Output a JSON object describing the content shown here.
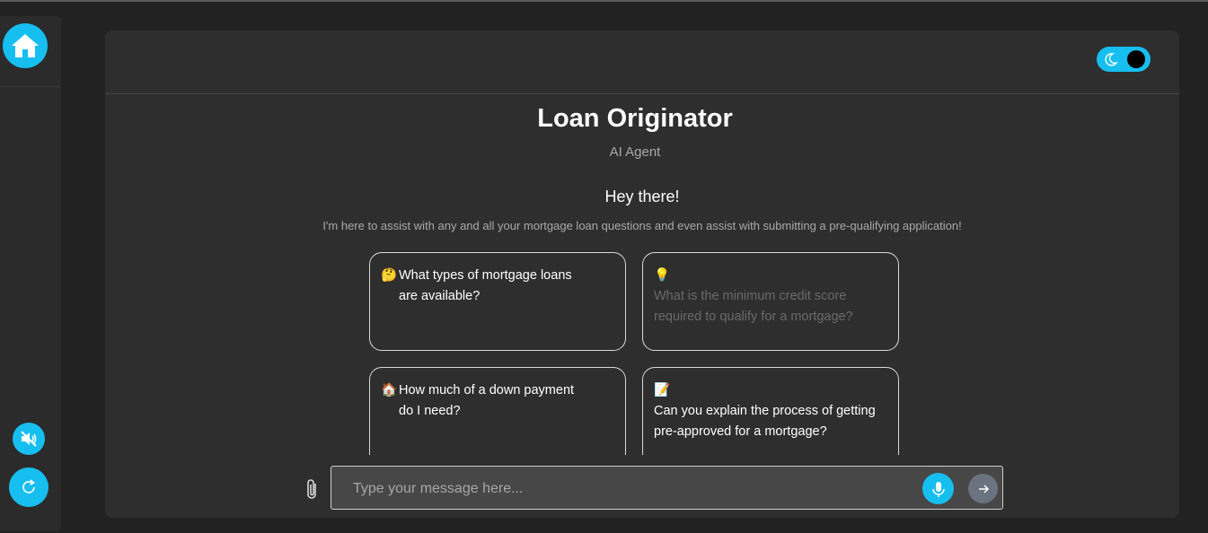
{
  "app": {
    "title": "Loan Originator",
    "subtitle": "AI Agent"
  },
  "sidebar": {
    "home_icon": "home-icon",
    "mute_icon": "speaker-muted-icon",
    "refresh_icon": "refresh-icon"
  },
  "header": {
    "theme_toggle_icon": "moon-icon",
    "dark_mode": true
  },
  "welcome": {
    "greeting": "Hey there!",
    "intro": "I'm here to assist with any and all your mortgage loan questions and even assist with submitting a pre-qualifying application!"
  },
  "suggestions": [
    {
      "emoji": "🤔",
      "text": "What types of mortgage loans are available?"
    },
    {
      "emoji": "💡",
      "text": "What is the minimum credit score required to qualify for a mortgage?"
    },
    {
      "emoji": "🏠",
      "text": "How much of a down payment do I need?"
    },
    {
      "emoji": "📝",
      "text": "Can you explain the process of getting pre-approved for a mortgage?"
    }
  ],
  "composer": {
    "placeholder": "Type your message here...",
    "value": "",
    "attach_icon": "paperclip-icon",
    "mic_icon": "microphone-icon",
    "send_icon": "arrow-right-icon"
  },
  "colors": {
    "accent": "#17bef0",
    "background": "#222222",
    "panel": "#2e2e2e"
  }
}
